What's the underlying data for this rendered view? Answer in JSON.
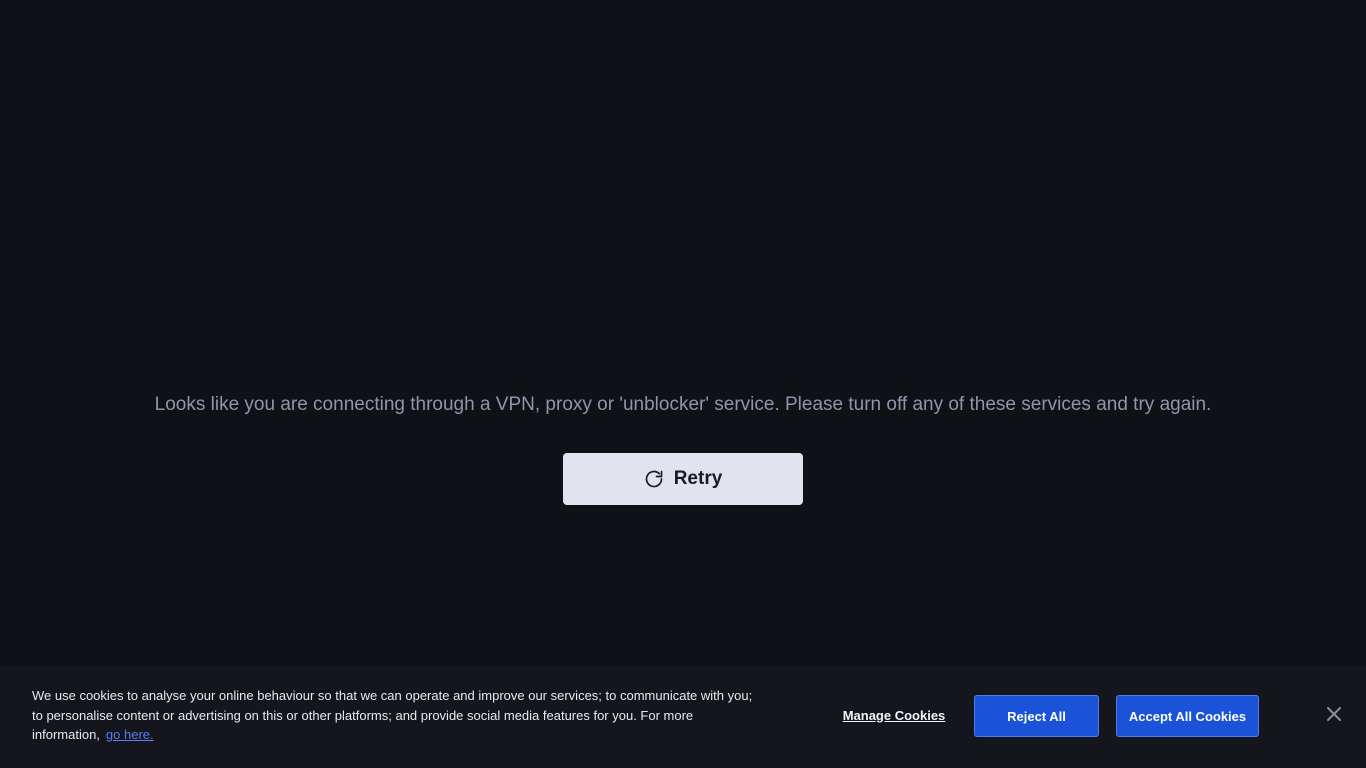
{
  "main": {
    "message": "Looks like you are connecting through a VPN, proxy or 'unblocker' service. Please turn off any of these services and try again.",
    "retry_label": "Retry"
  },
  "cookie_banner": {
    "text": "We use cookies to analyse your online behaviour so that we can operate and improve our services; to communicate with you; to personalise content or advertising on this or other platforms; and provide social media features for you. For more information,",
    "link_label": "go here.",
    "manage_label": "Manage Cookies",
    "reject_label": "Reject All",
    "accept_label": "Accept All Cookies",
    "close_icon": "close-icon"
  },
  "colors": {
    "background": "#101117",
    "banner_background": "#15161d",
    "message_text": "#8f95ab",
    "retry_button": "#e1e4ee",
    "primary_button": "#1a52d8",
    "link": "#5b7cf0"
  }
}
